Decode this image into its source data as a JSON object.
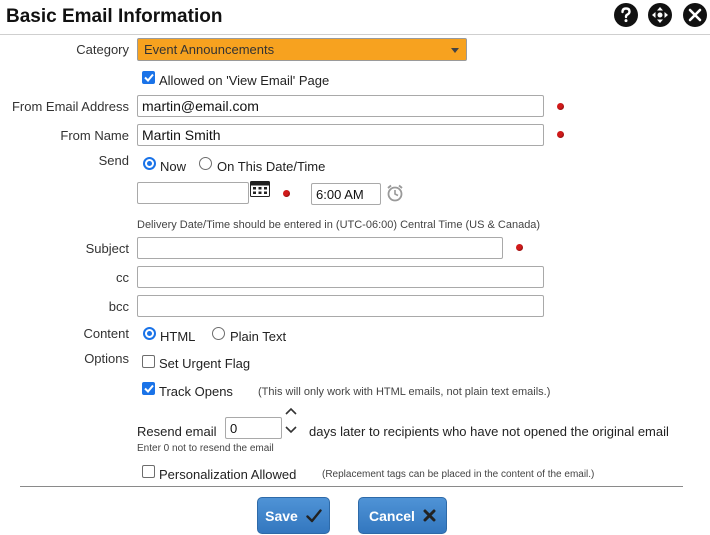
{
  "header": {
    "title": "Basic Email Information",
    "icons": [
      "help-icon",
      "move-icon",
      "close-icon"
    ]
  },
  "form": {
    "category": {
      "label": "Category",
      "value": "Event Announcements",
      "highlight_color": "#f7a21f"
    },
    "allowed_view": {
      "label": "Allowed on 'View Email' Page",
      "checked": true
    },
    "from_email": {
      "label": "From Email Address",
      "value": "martin@email.com"
    },
    "from_name": {
      "label": "From Name",
      "value": "Martin Smith"
    },
    "send": {
      "label": "Send",
      "option_now": "Now",
      "option_date": "On This Date/Time",
      "selected": "Now",
      "date_value": "",
      "time_value": "6:00 AM",
      "note": "Delivery Date/Time should be entered in (UTC-06:00) Central Time (US & Canada)"
    },
    "subject": {
      "label": "Subject",
      "value": ""
    },
    "cc": {
      "label": "cc",
      "value": ""
    },
    "bcc": {
      "label": "bcc",
      "value": ""
    },
    "content": {
      "label": "Content",
      "option_html": "HTML",
      "option_plain": "Plain Text",
      "selected": "HTML"
    },
    "options": {
      "label": "Options",
      "urgent": {
        "label": "Set Urgent Flag",
        "checked": false
      },
      "track_opens": {
        "label": "Track Opens",
        "checked": true,
        "note": "(This will only work with HTML emails, not plain text emails.)"
      },
      "resend": {
        "label_before": "Resend email",
        "value": "0",
        "label_after": "days later to recipients who have not opened the original email",
        "hint": "Enter 0 not to resend the email"
      },
      "personalization": {
        "label": "Personalization Allowed",
        "checked": false,
        "note": "(Replacement tags can be placed in the content of the email.)"
      }
    }
  },
  "footer": {
    "save_label": "Save",
    "cancel_label": "Cancel",
    "button_color": "#3f85cd"
  },
  "colors": {
    "required_dot": "#d11a1a",
    "check_accent": "#1a73e8"
  }
}
